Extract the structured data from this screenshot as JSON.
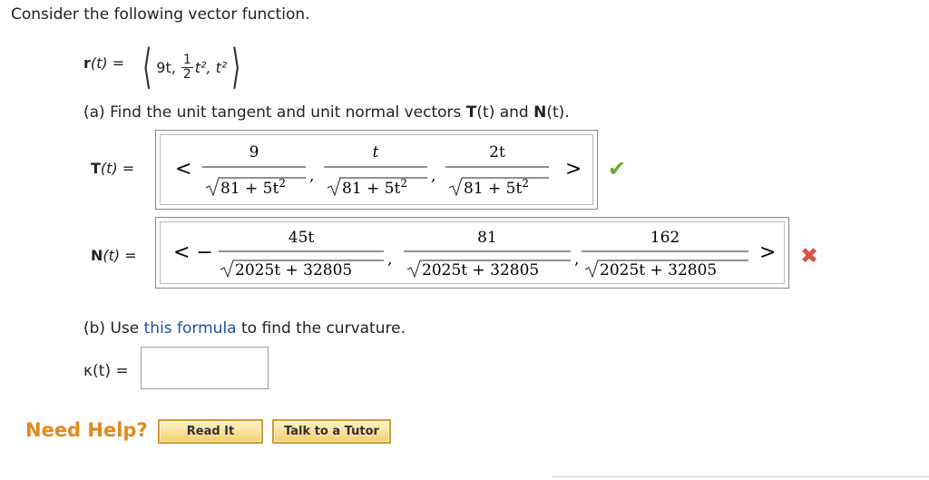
{
  "intro": "Consider the following vector function.",
  "r": {
    "label_bold": "r",
    "label_rest": "(t) =",
    "comp1": "9t,",
    "frac_num": "1",
    "frac_den": "2",
    "comp2_rest": "t², t²"
  },
  "part_a": {
    "text_pre": "(a) Find the unit tangent and unit normal vectors ",
    "T": "T",
    "mid": "(t) and ",
    "N": "N",
    "post": "(t)."
  },
  "T_answer": {
    "label_bold": "T",
    "label_rest": "(t) =",
    "open": "<",
    "close": ">",
    "nums": [
      "9",
      "t",
      "2t"
    ],
    "den": "81 + 5t",
    "den_exp": "2",
    "status": "correct"
  },
  "N_answer": {
    "label_bold": "N",
    "label_rest": "(t) =",
    "open": "< −",
    "close": ">",
    "nums": [
      "45t",
      "81",
      "162"
    ],
    "den": "2025t + 32805",
    "status": "incorrect"
  },
  "part_b": {
    "pre": "(b) Use ",
    "link": "this formula",
    "post": " to find the curvature."
  },
  "kappa": {
    "label": "κ(t) =",
    "value": ""
  },
  "help": {
    "label": "Need Help?",
    "read_it": "Read It",
    "tutor": "Talk to a Tutor"
  },
  "colors": {
    "check": "#6aaa3a",
    "cross": "#d9534f",
    "link": "#1f4fa8",
    "help": "#e08a1e"
  }
}
